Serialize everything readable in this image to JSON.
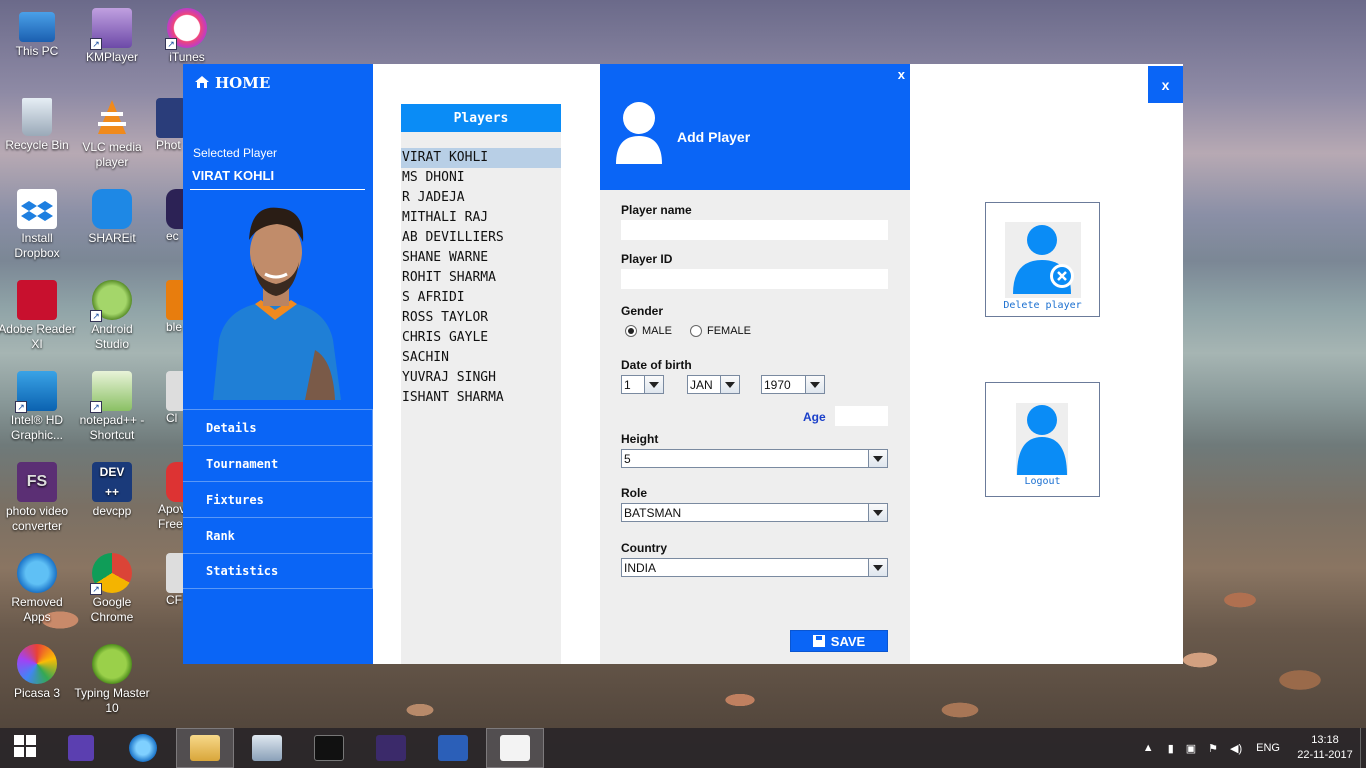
{
  "desktop": {
    "icons": [
      {
        "label": "This PC"
      },
      {
        "label": "KMPlayer"
      },
      {
        "label": "iTunes"
      },
      {
        "label": "Recycle Bin"
      },
      {
        "label": "VLC media player"
      },
      {
        "label": "Phot"
      },
      {
        "label": "Install Dropbox"
      },
      {
        "label": "SHAREit"
      },
      {
        "label": "ec"
      },
      {
        "label": "Adobe Reader XI"
      },
      {
        "label": "Android Studio"
      },
      {
        "label": "ble"
      },
      {
        "label": "Intel® HD Graphic..."
      },
      {
        "label": "notepad++ - Shortcut"
      },
      {
        "label": "Cl"
      },
      {
        "label": "photo video converter"
      },
      {
        "label": "devcpp"
      },
      {
        "label": "Apov Free"
      },
      {
        "label": "Removed Apps"
      },
      {
        "label": "Google Chrome"
      },
      {
        "label": "CF"
      },
      {
        "label": "Picasa 3"
      },
      {
        "label": "Typing Master 10"
      }
    ]
  },
  "sidebar": {
    "home_label": "HOME",
    "selected_label": "Selected Player",
    "selected_name": "VIRAT KOHLI",
    "nav": [
      "Details",
      "Tournament",
      "Fixtures",
      "Rank",
      "Statistics"
    ]
  },
  "players": {
    "header": "Players",
    "list": [
      "VIRAT KOHLI",
      "MS DHONI",
      "R JADEJA",
      "MITHALI RAJ",
      "AB DEVILLIERS",
      "SHANE WARNE",
      "ROHIT SHARMA",
      "S AFRIDI",
      "ROSS TAYLOR",
      "CHRIS GAYLE",
      "SACHIN",
      "YUVRAJ SINGH",
      "ISHANT SHARMA"
    ],
    "selected_index": 0
  },
  "form": {
    "title": "Add Player",
    "close": "x",
    "player_name_label": "Player name",
    "player_name_value": "",
    "player_id_label": "Player ID",
    "player_id_value": "",
    "gender_label": "Gender",
    "gender_male": "MALE",
    "gender_female": "FEMALE",
    "gender_selected": "MALE",
    "dob_label": "Date of birth",
    "dob_day": "1",
    "dob_month": "JAN",
    "dob_year": "1970",
    "age_label": "Age",
    "age_value": "",
    "height_label": "Height",
    "height_value": "5",
    "role_label": "Role",
    "role_value": "BATSMAN",
    "country_label": "Country",
    "country_value": "INDIA",
    "save_label": "SAVE"
  },
  "window": {
    "close": "x"
  },
  "actions": {
    "delete_label": "Delete player",
    "logout_label": "Logout"
  },
  "taskbar": {
    "language": "ENG",
    "time": "13:18",
    "date": "22-11-2017"
  },
  "colors": {
    "primary_blue": "#0a65f6",
    "players_header": "#0a8cf6",
    "panel_gray": "#eeeeee",
    "avatar_blue": "#0a8cf6"
  }
}
